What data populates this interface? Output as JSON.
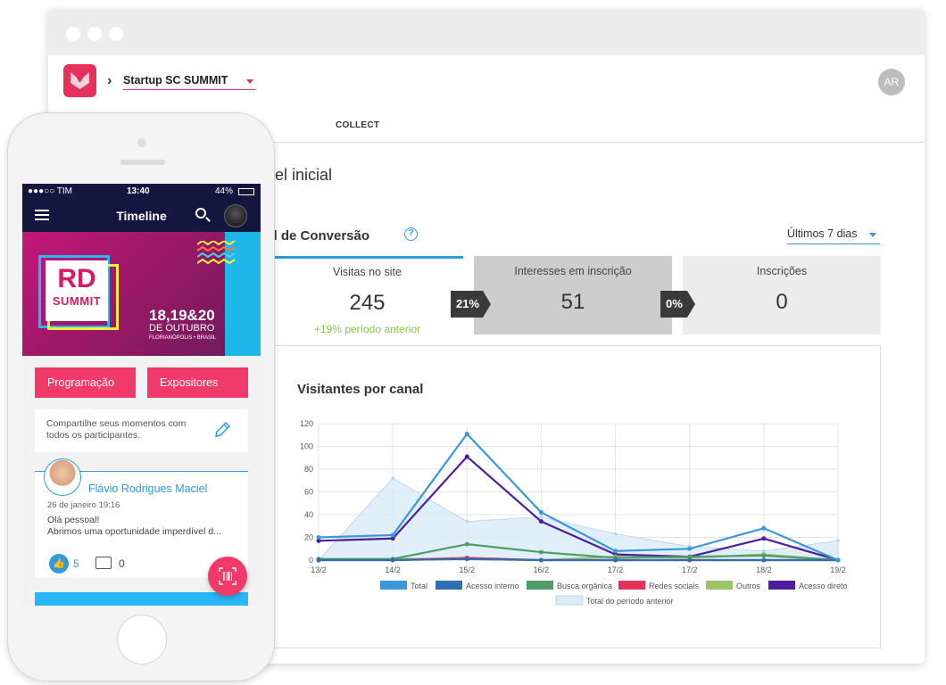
{
  "header": {
    "project_name": "Startup SC SUMMIT",
    "user_initials": "AR",
    "nav_item": "COLLECT"
  },
  "page": {
    "title": "ainel inicial",
    "funnel_title": "unil de Conversão",
    "period": "Últimos 7 dias"
  },
  "funnel": {
    "boxes": [
      {
        "label": "Visitas no site",
        "value": "245",
        "delta": "+19% período anterior"
      },
      {
        "label": "Interesses em inscrição",
        "value": "51"
      },
      {
        "label": "Inscrições",
        "value": "0"
      }
    ],
    "rates": [
      "21%",
      "0%"
    ]
  },
  "chart_data": {
    "type": "line",
    "title": "Visitantes por canal",
    "categories": [
      "13/2",
      "14/2",
      "15/2",
      "16/2",
      "17/2",
      "17/2",
      "18/2",
      "19/2"
    ],
    "ylim": [
      0,
      120
    ],
    "yticks": [
      "0",
      "20",
      "40",
      "60",
      "80",
      "100",
      "120"
    ],
    "grid": true,
    "legend_position": "bottom",
    "series": [
      {
        "name": "Total",
        "color": "#3b97d9",
        "values": [
          20,
          22,
          111,
          42,
          8,
          10,
          28,
          0
        ]
      },
      {
        "name": "Acesso interno",
        "color": "#2f6eb0",
        "values": [
          0,
          0,
          1,
          0,
          0,
          0,
          0,
          0
        ]
      },
      {
        "name": "Busca orgânica",
        "color": "#4f9d6a",
        "values": [
          1,
          1,
          14,
          7,
          2,
          3,
          4,
          0
        ]
      },
      {
        "name": "Redes sociais",
        "color": "#e6325a",
        "values": [
          0,
          0,
          2,
          0,
          0,
          0,
          0,
          0
        ]
      },
      {
        "name": "Outros",
        "color": "#9cc26a",
        "values": [
          1,
          1,
          1,
          0,
          3,
          2,
          5,
          0
        ]
      },
      {
        "name": "Acesso direto",
        "color": "#4b1e9e",
        "values": [
          17,
          19,
          91,
          34,
          5,
          3,
          19,
          0
        ]
      }
    ],
    "comparison": {
      "name": "Total do período anterior",
      "color": "#dcecf8",
      "values": [
        0,
        72,
        34,
        38,
        23,
        12,
        8,
        17
      ]
    }
  },
  "mobile": {
    "status": {
      "carrier": "●●●○○ TIM",
      "time": "13:40",
      "battery": "44%"
    },
    "app_title": "Timeline",
    "banner": {
      "logo_top": "RD",
      "logo_bottom": "SUMMIT",
      "date": "18,19&20",
      "month": "DE OUTUBRO",
      "city": "FLORIANÓPOLIS • BRASIL"
    },
    "buttons": [
      "Programação",
      "Expositores"
    ],
    "share_prompt": "Compartilhe seus momentos com todos os participantes.",
    "post": {
      "author": "Flávio Rodrigues Maciel",
      "date": "26 de janeiro 19:16",
      "line1": "Olá pessoal!",
      "line2": "Abrimos uma oportunidade imperdível d...",
      "likes": "5",
      "comments": "0"
    }
  }
}
